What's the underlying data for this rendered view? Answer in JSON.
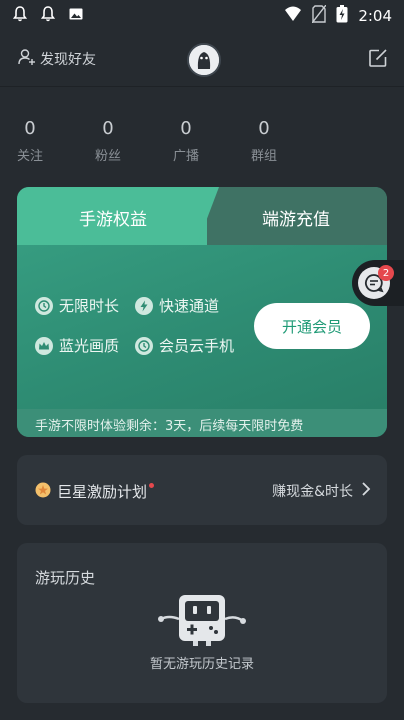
{
  "status_bar": {
    "time": "2:04",
    "icons": [
      "bell-icon",
      "bell-icon",
      "image-icon",
      "wifi-icon",
      "no-sim-icon",
      "battery-icon"
    ]
  },
  "header": {
    "find_friends": "发现好友",
    "icons": [
      "add-user-icon",
      "avatar",
      "edit-icon"
    ]
  },
  "stats": [
    {
      "value": "0",
      "label": "关注"
    },
    {
      "value": "0",
      "label": "粉丝"
    },
    {
      "value": "0",
      "label": "广播"
    },
    {
      "value": "0",
      "label": "群组"
    }
  ],
  "vip_card": {
    "tabs": [
      {
        "label": "手游权益",
        "active": true
      },
      {
        "label": "端游充值",
        "active": false
      }
    ],
    "perks": [
      "无限时长",
      "快速通道",
      "蓝光画质",
      "会员云手机"
    ],
    "open_button": "开通会员",
    "trial_text": "手游不限时体验剩余：3天，后续每天限时免费"
  },
  "floating_badge": {
    "count": "2"
  },
  "incentive": {
    "title": "巨星激励计划",
    "action": "赚现金&时长"
  },
  "history": {
    "title": "游玩历史",
    "empty_text": "暂无游玩历史记录"
  },
  "colors": {
    "background": "#262b30",
    "card": "#2f353b",
    "accent_green": "#2e8c73",
    "badge_red": "#e5484d"
  }
}
